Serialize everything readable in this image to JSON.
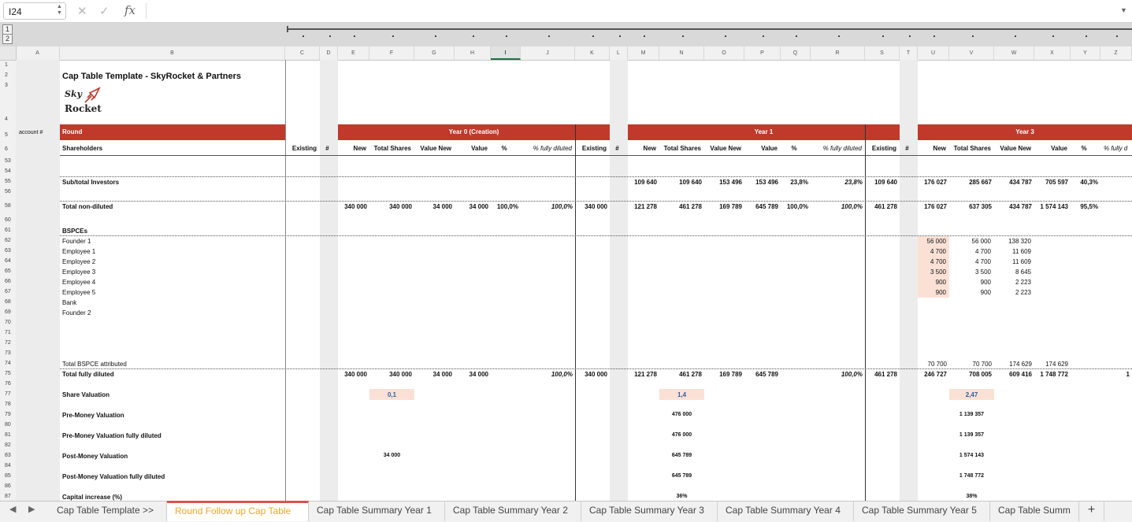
{
  "formula_bar": {
    "name_box": "I24",
    "fx": "fx",
    "cancel_icon": "✕",
    "enter_icon": "✓"
  },
  "outline_levels": [
    "1",
    "2"
  ],
  "columns": [
    "A",
    "B",
    "C",
    "D",
    "E",
    "F",
    "G",
    "H",
    "I",
    "J",
    "K",
    "L",
    "M",
    "N",
    "O",
    "P",
    "Q",
    "R",
    "S",
    "T",
    "U",
    "V",
    "W",
    "X",
    "Y",
    "Z"
  ],
  "selected_column": "I",
  "row_numbers": [
    "1",
    "2",
    "3",
    "4",
    "5",
    "6",
    "53",
    "54",
    "55",
    "56",
    "58",
    "60",
    "61",
    "62",
    "63",
    "64",
    "65",
    "66",
    "67",
    "68",
    "69",
    "70",
    "71",
    "72",
    "73",
    "74",
    "75",
    "76",
    "77",
    "78",
    "79",
    "80",
    "81",
    "82",
    "83",
    "84",
    "85",
    "86",
    "87"
  ],
  "title": "Cap Table Template - SkyRocket & Partners",
  "logo": {
    "line1": "Sky",
    "line2": "Rocket",
    "accent": "#c0392b"
  },
  "labels": {
    "account": "account #",
    "round": "Round",
    "shareholders": "Shareholders"
  },
  "rounds": [
    "Year 0 (Creation)",
    "Year 1",
    "Year 3"
  ],
  "subheaders": {
    "existing": "Existing",
    "hash": "#",
    "new": "New",
    "total_shares": "Total Shares",
    "value_new": "Value New",
    "value": "Value",
    "pct": "%",
    "fully_diluted": "% fully diluted",
    "fully_cut": "% fully d"
  },
  "rows": {
    "subtotal_investors": {
      "label": "Sub/total Investors",
      "m": "109 640",
      "n": "109 640",
      "o": "153 496",
      "p": "153 496",
      "q": "23,8%",
      "r": "23,8%",
      "s": "109 640",
      "u": "176 027",
      "v": "285 667",
      "w": "434 787",
      "x": "705 597",
      "y": "40,3%"
    },
    "total_non_diluted": {
      "label": "Total non-diluted",
      "e": "340 000",
      "f": "340 000",
      "g": "34 000",
      "h": "34 000",
      "i": "100,0%",
      "j": "100,0%",
      "k": "340 000",
      "m": "121 278",
      "n": "461 278",
      "o": "169 789",
      "p": "645 789",
      "q": "100,0%",
      "r": "100,0%",
      "s": "461 278",
      "u": "176 027",
      "v": "637 305",
      "w": "434 787",
      "x": "1 574 143",
      "y": "95,5%"
    },
    "bspces": "BSPCEs",
    "bspce_list": [
      {
        "name": "Founder 1",
        "u": "56 000",
        "v": "56 000",
        "w": "138 320"
      },
      {
        "name": "Employee 1",
        "u": "4 700",
        "v": "4 700",
        "w": "11 609"
      },
      {
        "name": "Employee 2",
        "u": "4 700",
        "v": "4 700",
        "w": "11 609"
      },
      {
        "name": "Employee 3",
        "u": "3 500",
        "v": "3 500",
        "w": "8 645"
      },
      {
        "name": "Employee 4",
        "u": "900",
        "v": "900",
        "w": "2 223"
      },
      {
        "name": "Employee 5",
        "u": "900",
        "v": "900",
        "w": "2 223"
      },
      {
        "name": "Bank",
        "u": "",
        "v": "",
        "w": ""
      },
      {
        "name": "Founder 2",
        "u": "",
        "v": "",
        "w": ""
      }
    ],
    "total_bspce": {
      "label": "Total BSPCE attributed",
      "u": "70 700",
      "v": "70 700",
      "w": "174 629",
      "x": "174 629"
    },
    "total_fully_diluted": {
      "label": "Total fully diluted",
      "e": "340 000",
      "f": "340 000",
      "g": "34 000",
      "h": "34 000",
      "j": "100,0%",
      "k": "340 000",
      "m": "121 278",
      "n": "461 278",
      "o": "169 789",
      "p": "645 789",
      "r": "100,0%",
      "s": "461 278",
      "u": "246 727",
      "v": "708 005",
      "w": "609 416",
      "x": "1 748 772",
      "z": "1"
    },
    "share_valuation": {
      "label": "Share Valuation",
      "f": "0,1",
      "n": "1,4",
      "v": "2,47"
    },
    "pre_money": {
      "label": "Pre-Money Valuation",
      "n": "476 000",
      "v": "1 139 357"
    },
    "pre_money_fd": {
      "label": "Pre-Money Valuation fully diluted",
      "n": "476 000",
      "v": "1 139 357"
    },
    "post_money": {
      "label": "Post-Money Valuation",
      "f": "34 000",
      "n": "645 789",
      "v": "1 574 143"
    },
    "post_money_fd": {
      "label": "Post-Money Valuation fully diluted",
      "n": "645 789",
      "v": "1 748 772"
    },
    "capital_increase": {
      "label": "Capital increase (%)",
      "n": "36%",
      "v": "38%"
    }
  },
  "tabs": [
    "Cap Table Template >>",
    "Round Follow up Cap Table",
    "Cap Table Summary Year 1",
    "Cap Table Summary Year 2",
    "Cap Table Summary Year 3",
    "Cap Table Summary Year 4",
    "Cap Table Summary Year 5",
    "Cap Table Summ"
  ],
  "active_tab": 1,
  "add_tab": "+",
  "nav": {
    "prev": "◀",
    "next": "▶"
  },
  "colors": {
    "header_red": "#c0392b",
    "peach": "#fbe1d5",
    "active_tab_text": "#f0a91a",
    "value_blue": "#2f5e9e"
  }
}
